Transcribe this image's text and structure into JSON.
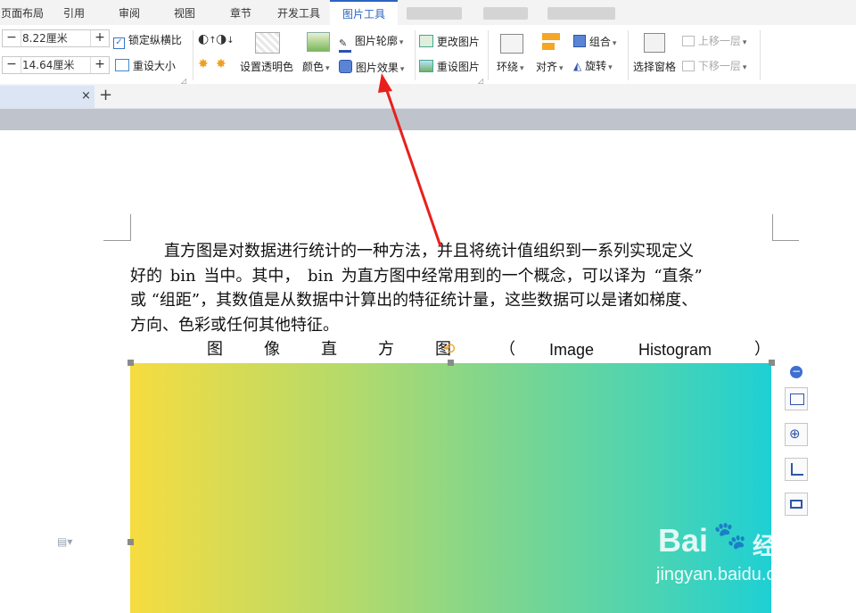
{
  "colors": {
    "accent": "#2b65c2",
    "arrow": "#e8201c",
    "picture_gradient_start": "#f6dc40",
    "picture_gradient_end": "#1ed0d4"
  },
  "menu": {
    "tabs": [
      "页面布局",
      "引用",
      "审阅",
      "视图",
      "章节",
      "开发工具",
      "图片工具"
    ],
    "active": "图片工具"
  },
  "ribbon": {
    "height_value": "8.22厘米",
    "width_value": "14.64厘米",
    "lock_ratio": "锁定纵横比",
    "reset_size": "重设大小",
    "set_transparent": "设置透明色",
    "color": "颜色",
    "picture_outline": "图片轮廓",
    "picture_effects": "图片效果",
    "change_picture": "更改图片",
    "reset_picture": "重设图片",
    "wrap": "环绕",
    "align": "对齐",
    "group": "组合",
    "rotate": "旋转",
    "selection_pane": "选择窗格",
    "bring_forward": "上移一层",
    "send_backward": "下移一层"
  },
  "doc": {
    "para_lines": [
      "直方图是对数据进行统计的一种方法，并且将统计值组织到一系列实现定义",
      "好的 bin 当中。其中， bin 为直方图中经常用到的一个概念，可以译为 “直条”",
      "或 “组距”，其数值是从数据中计算出的特征统计量，这些数据可以是诸如梯度、",
      "方向、色彩或任何其他特征。"
    ],
    "caption_cn": [
      "图",
      "像",
      "直",
      "方",
      "图",
      "（"
    ],
    "caption_en": [
      "Image",
      "Histogram"
    ],
    "caption_close": "）"
  },
  "watermark": {
    "brand": "Bai",
    "brand2": "经验",
    "url": "jingyan.baidu.com"
  }
}
